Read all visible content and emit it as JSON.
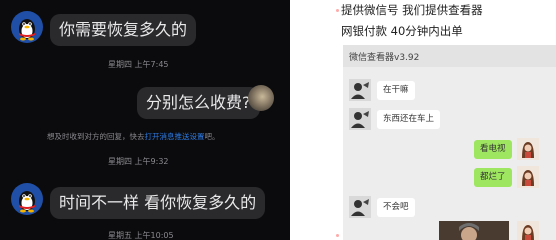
{
  "left_chat": {
    "messages": [
      {
        "text": "你需要恢复多久的"
      },
      {
        "text": "分别怎么收费?"
      },
      {
        "text": "时间不一样 看你恢复多久的"
      }
    ],
    "times": [
      "星期四 上午7:45",
      "星期四 上午9:32",
      "星期五 上午10:05"
    ],
    "notice": {
      "prefix": "想及时收到对方的回复，快去",
      "link": "打开消息推送设置",
      "suffix": "吧。"
    },
    "colors": {
      "bubble": "#2a2a2d",
      "link": "#2c7be5"
    }
  },
  "right_panel": {
    "line1": "提供微信号 我们提供查看器",
    "line2": "网银付款  40分钟内出单",
    "viewer_title": "微信查看器v3.92",
    "messages": [
      {
        "text": "在干嘛",
        "side": "left"
      },
      {
        "text": "东西还在车上",
        "side": "left"
      },
      {
        "text": "看电视",
        "side": "right"
      },
      {
        "text": "都烂了",
        "side": "right"
      },
      {
        "text": "不会吧",
        "side": "left"
      }
    ],
    "colors": {
      "green_bubble": "#9ee660"
    }
  }
}
